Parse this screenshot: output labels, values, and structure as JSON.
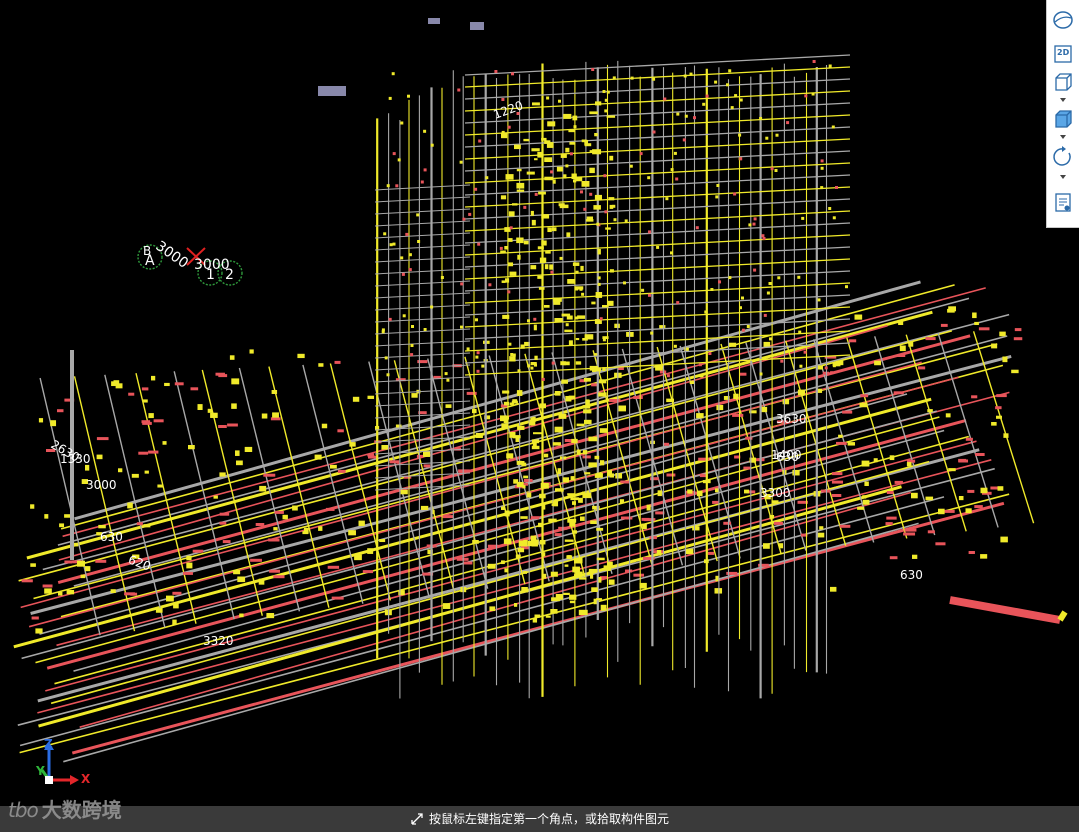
{
  "status": {
    "prompt": "按鼠标左键指定第一个角点，或拾取构件图元"
  },
  "watermark": {
    "logo": "tbo",
    "text": "大数跨境"
  },
  "toolbar": {
    "items": [
      {
        "name": "view-ball-icon"
      },
      {
        "name": "view-2d-icon",
        "label": "2D"
      },
      {
        "name": "cube-outline-icon"
      },
      {
        "name": "cube-shaded-icon"
      },
      {
        "name": "rotate-icon"
      },
      {
        "name": "list-view-icon"
      }
    ]
  },
  "axis": {
    "x": "X",
    "y": "Y",
    "z": "Z",
    "x_color": "#e3262a",
    "y_color": "#2fb53a",
    "z_color": "#2a6de3"
  },
  "grid_markers": {
    "a": "A",
    "b": "B",
    "one": "1",
    "two": "2",
    "dim_left": "3000",
    "dim_right": "3000"
  },
  "dimension_labels": [
    "1220",
    "2630",
    "3000",
    "630",
    "3320",
    "620",
    "3630",
    "1400",
    "630",
    "3300",
    "630",
    "1330"
  ],
  "colors": {
    "pipe_yellow": "#f0ea2a",
    "pipe_red": "#e8545a",
    "pipe_gray": "#a8a8a8",
    "marker_green": "#2f9a3c",
    "marker_red": "#e02020"
  }
}
